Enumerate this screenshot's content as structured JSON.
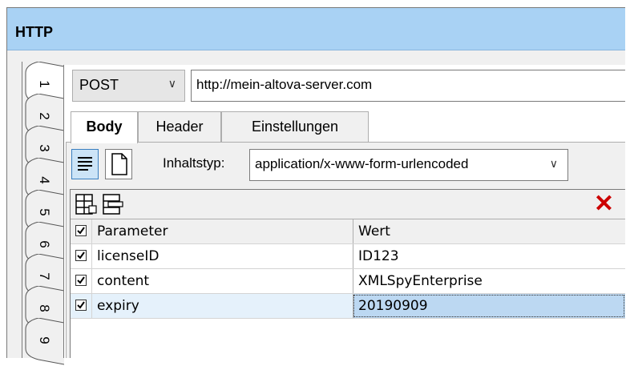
{
  "window": {
    "title": "HTTP"
  },
  "side_tabs": [
    "1",
    "2",
    "3",
    "4",
    "5",
    "6",
    "7",
    "8",
    "9"
  ],
  "request": {
    "method": "POST",
    "url": "http://mein-altova-server.com"
  },
  "tabs": [
    {
      "label": "Body",
      "active": true
    },
    {
      "label": "Header",
      "active": false
    },
    {
      "label": "Einstellungen",
      "active": false
    }
  ],
  "body": {
    "content_type_label": "Inhaltstyp:",
    "content_type_value": "application/x-www-form-urlencoded"
  },
  "params_table": {
    "columns": [
      "Parameter",
      "Wert"
    ],
    "rows": [
      {
        "checked": true,
        "parameter": "licenseID",
        "value": "ID123",
        "selected": false
      },
      {
        "checked": true,
        "parameter": "content",
        "value": "XMLSpyEnterprise",
        "selected": false
      },
      {
        "checked": true,
        "parameter": "expiry",
        "value": "20190909",
        "selected": true
      }
    ]
  },
  "colors": {
    "titlebar": "#a9d2f4",
    "selection": "#bcd8f2",
    "delete": "#cc0000"
  }
}
